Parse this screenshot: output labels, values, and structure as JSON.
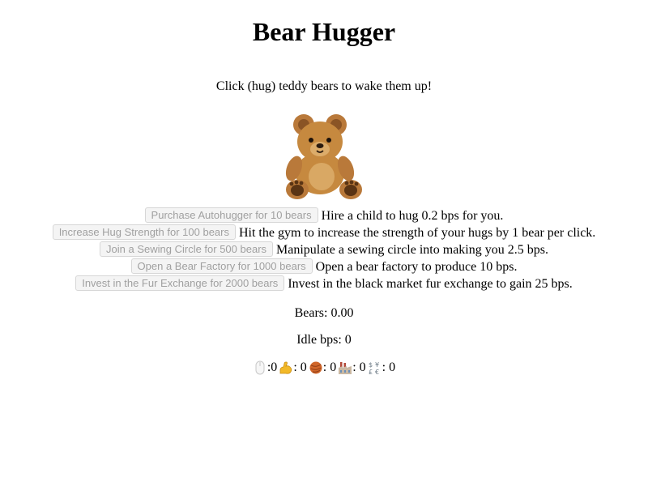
{
  "title": "Bear Hugger",
  "subtitle": "Click (hug) teddy bears to wake them up!",
  "bear": {
    "icon": "teddy-bear-icon"
  },
  "upgrades": [
    {
      "button_label": "Purchase Autohugger for 10 bears",
      "description": "Hire a child to hug 0.2 bps for you."
    },
    {
      "button_label": "Increase Hug Strength for 100 bears",
      "description": "Hit the gym to increase the strength of your hugs by 1 bear per click."
    },
    {
      "button_label": "Join a Sewing Circle for 500 bears",
      "description": "Manipulate a sewing circle into making you 2.5 bps."
    },
    {
      "button_label": "Open a Bear Factory for 1000 bears",
      "description": "Open a bear factory to produce 10 bps."
    },
    {
      "button_label": "Invest in the Fur Exchange for 2000 bears",
      "description": "Invest in the black market fur exchange to gain 25 bps."
    }
  ],
  "stats": {
    "bears": "Bears: 0.00",
    "idle_bps": "Idle bps: 0"
  },
  "counts": [
    {
      "icon": "mouse-icon",
      "text": ":0"
    },
    {
      "icon": "flexed-biceps-icon",
      "text": ": 0"
    },
    {
      "icon": "yarn-icon",
      "text": ": 0"
    },
    {
      "icon": "factory-icon",
      "text": ": 0"
    },
    {
      "icon": "currency-exchange-icon",
      "text": ": 0"
    }
  ],
  "colors": {
    "disabled_button_text": "#a0a0a0",
    "bear_fur": "#c6893f",
    "bear_dark": "#7a4a1c"
  }
}
